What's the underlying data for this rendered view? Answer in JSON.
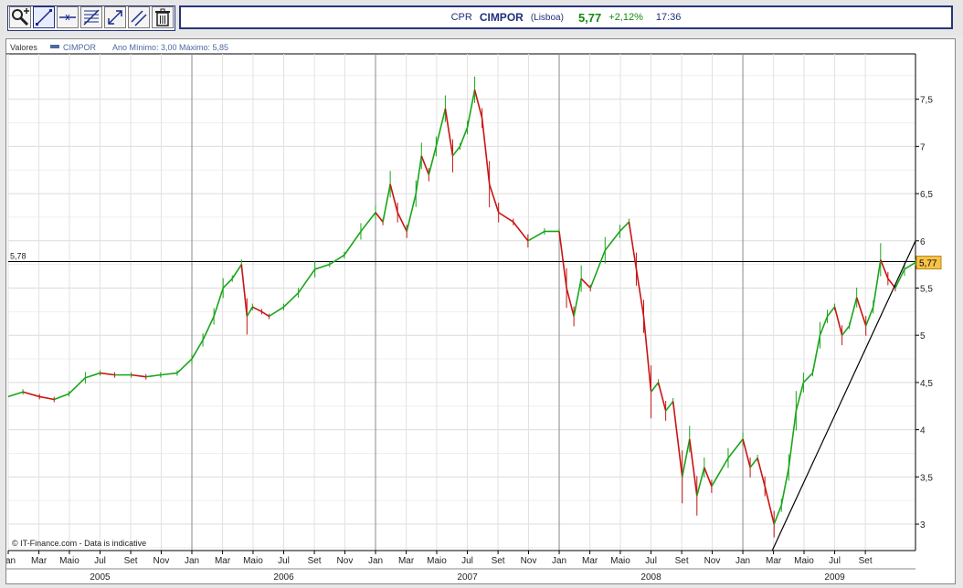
{
  "toolbar": {
    "tools": [
      {
        "name": "zoom-tool",
        "icon": "magnifier-icon"
      },
      {
        "name": "trendline-tool",
        "icon": "trendline-icon"
      },
      {
        "name": "horizontal-line-tool",
        "icon": "horizontal-line-icon"
      },
      {
        "name": "fibonacci-tool",
        "icon": "fibonacci-icon"
      },
      {
        "name": "arrow-tool",
        "icon": "arrow-icon"
      },
      {
        "name": "parallel-lines-tool",
        "icon": "parallel-lines-icon"
      },
      {
        "name": "delete-tool",
        "icon": "trash-icon"
      }
    ]
  },
  "quote": {
    "prefix": "CPR",
    "symbol": "CIMPOR",
    "exchange": "(Lisboa)",
    "price": "5,77",
    "change": "+2,12%",
    "time": "17:36"
  },
  "colors": {
    "up": "#1aa51a",
    "down": "#c81414",
    "accent": "#20307a",
    "badge": "#f7c24a"
  },
  "chart_data": {
    "type": "line",
    "legend": {
      "label": "Valores",
      "series": "CIMPOR",
      "range": "Ano Mínimo: 3,00 Máximo: 5,85"
    },
    "y_ticks": [
      "3",
      "3,5",
      "4",
      "4,5",
      "5",
      "5,5",
      "6",
      "6,5",
      "7",
      "7,5"
    ],
    "y_tick_values": [
      3,
      3.5,
      4,
      4.5,
      5,
      5.5,
      6,
      6.5,
      7,
      7.5
    ],
    "ylim": [
      2.72,
      7.98
    ],
    "xlim": [
      2005.0,
      2009.94
    ],
    "x_month_labels": [
      "Jan",
      "Mar",
      "Maio",
      "Jul",
      "Set",
      "Nov",
      "Jan",
      "Mar",
      "Maio",
      "Jul",
      "Set",
      "Nov",
      "Jan",
      "Mar",
      "Maio",
      "Jul",
      "Set",
      "Nov",
      "Jan",
      "Mar",
      "Maio",
      "Jul",
      "Set",
      "Nov",
      "Jan",
      "Mar",
      "Maio",
      "Jul",
      "Set"
    ],
    "x_month_values": [
      2005.0,
      2005.167,
      2005.333,
      2005.5,
      2005.667,
      2005.833,
      2006.0,
      2006.167,
      2006.333,
      2006.5,
      2006.667,
      2006.833,
      2007.0,
      2007.167,
      2007.333,
      2007.5,
      2007.667,
      2007.833,
      2008.0,
      2008.167,
      2008.333,
      2008.5,
      2008.667,
      2008.833,
      2009.0,
      2009.167,
      2009.333,
      2009.5,
      2009.667
    ],
    "x_year_labels": [
      "2005",
      "2006",
      "2007",
      "2008",
      "2009"
    ],
    "x_year_values": [
      2005.5,
      2006.5,
      2007.5,
      2008.5,
      2009.5
    ],
    "grid": true,
    "reference_line": {
      "label": "5,78",
      "value": 5.78
    },
    "last_value_badge": "5,77",
    "trendline": [
      [
        2009.16,
        2.72
      ],
      [
        2009.94,
        6.0
      ]
    ],
    "annotation": "© IT-Finance.com - Data is indicative",
    "series": [
      {
        "x": [
          2005.0,
          2005.08,
          2005.17,
          2005.25,
          2005.33,
          2005.42,
          2005.5,
          2005.58,
          2005.67,
          2005.75,
          2005.83,
          2005.92,
          2006.0,
          2006.06,
          2006.12,
          2006.17,
          2006.22,
          2006.27,
          2006.3,
          2006.33,
          2006.38,
          2006.42,
          2006.5,
          2006.58,
          2006.67,
          2006.75,
          2006.83,
          2006.92,
          2007.0,
          2007.04,
          2007.08,
          2007.12,
          2007.17,
          2007.22,
          2007.25,
          2007.29,
          2007.33,
          2007.38,
          2007.42,
          2007.46,
          2007.5,
          2007.54,
          2007.58,
          2007.62,
          2007.67,
          2007.75,
          2007.83,
          2007.92,
          2008.0,
          2008.04,
          2008.08,
          2008.12,
          2008.17,
          2008.25,
          2008.33,
          2008.38,
          2008.42,
          2008.46,
          2008.5,
          2008.54,
          2008.58,
          2008.62,
          2008.67,
          2008.71,
          2008.75,
          2008.79,
          2008.83,
          2008.92,
          2009.0,
          2009.04,
          2009.08,
          2009.12,
          2009.17,
          2009.21,
          2009.25,
          2009.29,
          2009.33,
          2009.38,
          2009.42,
          2009.46,
          2009.5,
          2009.54,
          2009.58,
          2009.62,
          2009.67,
          2009.71,
          2009.75,
          2009.79,
          2009.83,
          2009.88,
          2009.94
        ],
        "y": [
          4.35,
          4.4,
          4.35,
          4.32,
          4.38,
          4.55,
          4.6,
          4.58,
          4.58,
          4.56,
          4.58,
          4.6,
          4.75,
          4.95,
          5.2,
          5.5,
          5.6,
          5.75,
          5.2,
          5.3,
          5.25,
          5.2,
          5.3,
          5.45,
          5.7,
          5.75,
          5.85,
          6.1,
          6.3,
          6.2,
          6.6,
          6.3,
          6.1,
          6.5,
          6.9,
          6.7,
          7.0,
          7.4,
          6.9,
          7.0,
          7.2,
          7.6,
          7.3,
          6.6,
          6.3,
          6.2,
          6.0,
          6.1,
          6.1,
          5.5,
          5.2,
          5.6,
          5.5,
          5.9,
          6.1,
          6.2,
          5.7,
          5.2,
          4.4,
          4.5,
          4.2,
          4.3,
          3.5,
          3.9,
          3.3,
          3.6,
          3.4,
          3.7,
          3.9,
          3.6,
          3.7,
          3.4,
          3.0,
          3.2,
          3.6,
          4.2,
          4.5,
          4.6,
          5.0,
          5.2,
          5.3,
          5.0,
          5.1,
          5.4,
          5.1,
          5.3,
          5.8,
          5.6,
          5.5,
          5.7,
          5.77
        ]
      }
    ]
  }
}
